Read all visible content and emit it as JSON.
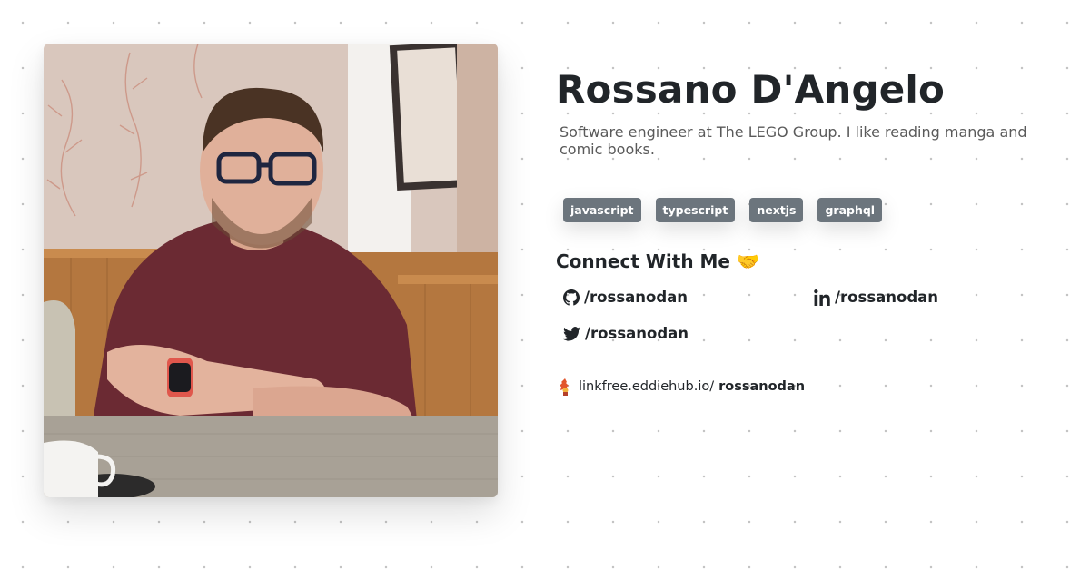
{
  "profile": {
    "name": "Rossano D'Angelo",
    "bio": "Software engineer at The LEGO Group. I like reading manga and comic books.",
    "tags": [
      "javascript",
      "typescript",
      "nextjs",
      "graphql"
    ]
  },
  "connect": {
    "title": "Connect With Me",
    "emoji": "🤝",
    "links": [
      {
        "network": "github",
        "icon": "github-icon",
        "handle": "/rossanodan"
      },
      {
        "network": "linkedin",
        "icon": "linkedin-icon",
        "handle": "/rossanodan"
      },
      {
        "network": "twitter",
        "icon": "twitter-icon",
        "handle": "/rossanodan"
      }
    ]
  },
  "footer": {
    "domain": "linkfree.eddiehub.io/",
    "username": "rossanodan"
  },
  "colors": {
    "text": "#212529",
    "tag_bg": "#6c757d",
    "bio_text": "#5a5a5a",
    "dot": "#c4c4c4"
  }
}
